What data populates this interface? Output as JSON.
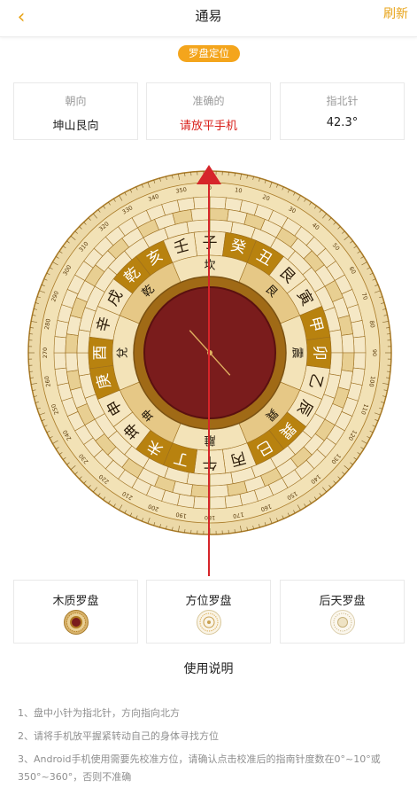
{
  "header": {
    "back_icon": "chevron-left-icon",
    "title": "通易",
    "refresh_label": "刷新"
  },
  "badge": {
    "label": "罗盘定位"
  },
  "info": [
    {
      "label": "朝向",
      "value": "坤山艮向"
    },
    {
      "label": "准确的",
      "value": "请放平手机"
    },
    {
      "label": "指北针",
      "value": "42.3°"
    }
  ],
  "compass": {
    "mountains": [
      "子",
      "癸",
      "丑",
      "艮",
      "寅",
      "甲",
      "卯",
      "乙",
      "辰",
      "巽",
      "巳",
      "丙",
      "午",
      "丁",
      "未",
      "坤",
      "申",
      "庚",
      "酉",
      "辛",
      "戌",
      "乾",
      "亥",
      "壬"
    ],
    "trigrams": [
      "坎",
      "艮",
      "震",
      "巽",
      "離",
      "坤",
      "兌",
      "乾"
    ],
    "degree_labels": [
      "0",
      "10",
      "20",
      "30",
      "40",
      "50",
      "60",
      "70",
      "80",
      "90",
      "100",
      "110",
      "120",
      "130",
      "140",
      "150",
      "160",
      "170",
      "180",
      "190",
      "200",
      "210",
      "220",
      "230",
      "240",
      "250",
      "260",
      "270",
      "280",
      "290",
      "300",
      "310",
      "320",
      "330",
      "340",
      "350"
    ],
    "colors": {
      "gold": "#b8820f",
      "cream": "#f5e6c0",
      "dark_red": "#7a1c1c",
      "needle": "#d6252a"
    }
  },
  "compass_types": [
    {
      "label": "木质罗盘"
    },
    {
      "label": "方位罗盘"
    },
    {
      "label": "后天罗盘"
    }
  ],
  "instructions": {
    "title": "使用说明",
    "items": [
      "1、盘中小针为指北针，方向指向北方",
      "2、请将手机放平握紧转动自己的身体寻找方位",
      "3、Android手机使用需要先校准方位，请确认点击校准后的指南针度数在0°~10°或350°~360°，否则不准确"
    ]
  }
}
